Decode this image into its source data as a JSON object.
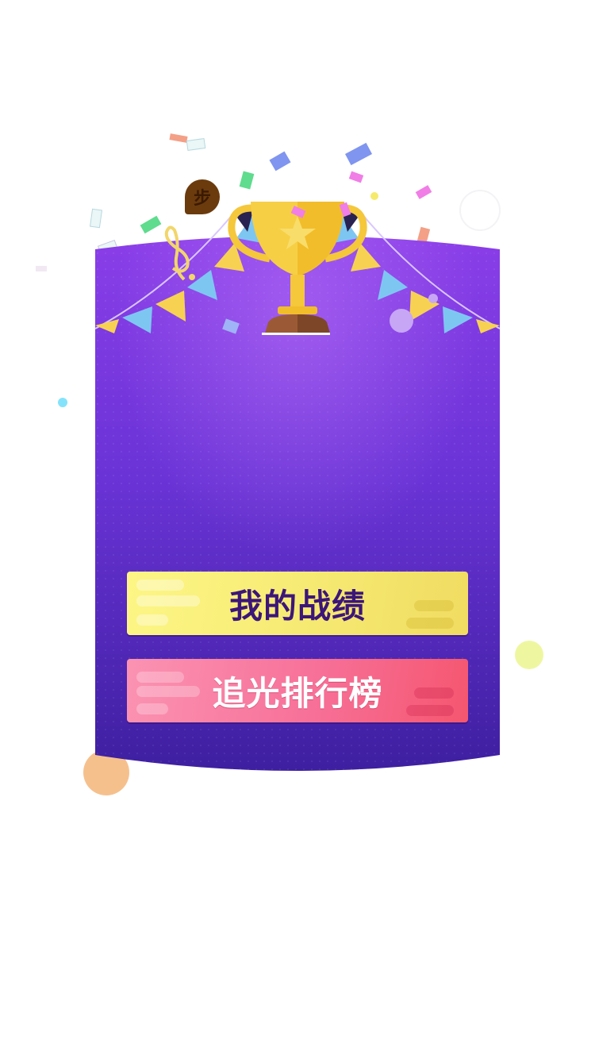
{
  "screen": {
    "badge_text": "步",
    "badge_icon": "step-badge-icon",
    "trophy_icon": "trophy-icon",
    "music_icon": "treble-clef-icon"
  },
  "buttons": {
    "record_label": "我的战绩",
    "ranking_label": "追光排行榜"
  },
  "colors": {
    "card_top": "#8a3ee8",
    "card_bottom": "#3e1fa0",
    "record_button": "#f7ec76",
    "ranking_button": "#f6628a",
    "record_text": "#3c1679",
    "ranking_text": "#ffffff"
  }
}
